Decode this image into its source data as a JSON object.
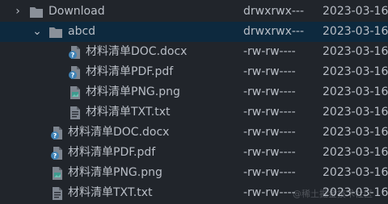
{
  "rows": [
    {
      "name": "Download",
      "perm": "drwxrwx---",
      "date": "2023-03-16",
      "type": "folder",
      "expanded": false,
      "icon": "folder-icon"
    },
    {
      "name": "abcd",
      "perm": "drwxrwx---",
      "date": "2023-03-16",
      "type": "folder",
      "expanded": true,
      "selected": true,
      "icon": "folder-icon"
    },
    {
      "name": "材料清单DOC.docx",
      "perm": "-rw-rw----",
      "date": "2023-03-16",
      "type": "file",
      "icon": "unknown-document-icon"
    },
    {
      "name": "材料清单PDF.pdf",
      "perm": "-rw-rw----",
      "date": "2023-03-16",
      "type": "file",
      "icon": "unknown-document-icon"
    },
    {
      "name": "材料清单PNG.png",
      "perm": "-rw-rw----",
      "date": "2023-03-16",
      "type": "file",
      "icon": "image-file-icon"
    },
    {
      "name": "材料清单TXT.txt",
      "perm": "-rw-rw----",
      "date": "2023-03-16",
      "type": "file",
      "icon": "text-file-icon"
    },
    {
      "name": "材料清单DOC.docx",
      "perm": "-rw-rw----",
      "date": "2023-03-16",
      "type": "file",
      "icon": "unknown-document-icon"
    },
    {
      "name": "材料清单PDF.pdf",
      "perm": "-rw-rw----",
      "date": "2023-03-16",
      "type": "file",
      "icon": "unknown-document-icon"
    },
    {
      "name": "材料清单PNG.png",
      "perm": "-rw-rw----",
      "date": "2023-03-16",
      "type": "file",
      "icon": "image-file-icon"
    },
    {
      "name": "材料清单TXT.txt",
      "perm": "-rw-rw----",
      "date": "2023-03-16",
      "type": "file",
      "icon": "text-file-icon"
    }
  ],
  "watermark": "@稀土掘金技术社区",
  "colors": {
    "background": "#21252b",
    "selection": "#0d293e",
    "text": "#b9bec6",
    "folder": "#8a9099"
  }
}
